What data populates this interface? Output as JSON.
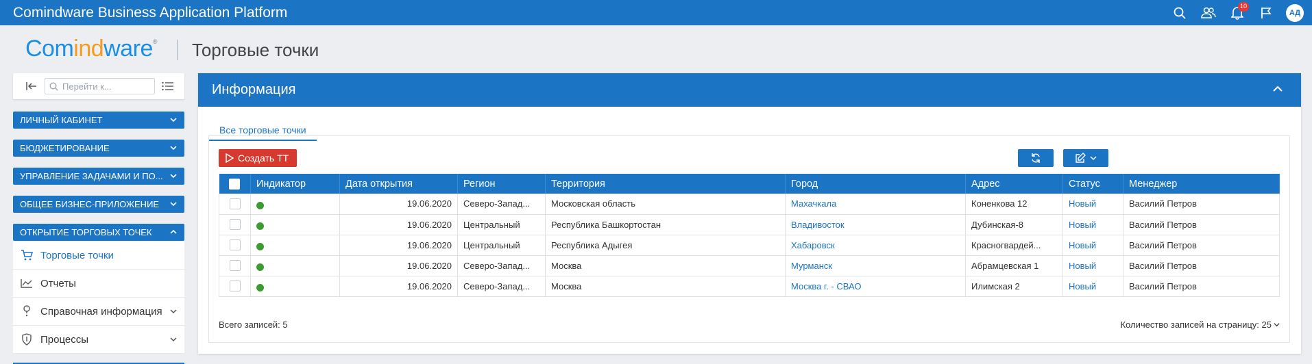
{
  "app": {
    "title": "Comindware Business Application Platform",
    "notifications_count": "10",
    "user_initials": "АД"
  },
  "header": {
    "logo_main": "Com",
    "logo_accent": "ind",
    "logo_tail": "ware",
    "logo_mark": "®",
    "page_title": "Торговые точки"
  },
  "sidebar": {
    "search_placeholder": "Перейти к...",
    "sections": [
      {
        "label": "Личный кабинет"
      },
      {
        "label": "Бюджетирование"
      },
      {
        "label": "Управление задачами и по..."
      },
      {
        "label": "Общее бизнес-приложение"
      },
      {
        "label": "Открытие торговых точек"
      }
    ],
    "items": [
      {
        "label": "Торговые точки",
        "icon": "cart-icon"
      },
      {
        "label": "Отчеты",
        "icon": "chart-icon"
      },
      {
        "label": "Справочная информация",
        "icon": "info-icon"
      },
      {
        "label": "Процессы",
        "icon": "shield-icon"
      }
    ]
  },
  "panel": {
    "title": "Информация",
    "tab": "Все торговые точки",
    "create_button": "Создать ТТ",
    "columns": [
      "Индикатор",
      "Дата открытия",
      "Регион",
      "Территория",
      "Город",
      "Адрес",
      "Статус",
      "Менеджер"
    ],
    "rows": [
      {
        "date": "19.06.2020",
        "region": "Северо-Запад...",
        "territory": "Московская область",
        "city": "Махачкала",
        "address": "Коненкова 12",
        "status": "Новый",
        "manager": "Василий Петров"
      },
      {
        "date": "19.06.2020",
        "region": "Центральный",
        "territory": "Республика Башкортостан",
        "city": "Владивосток",
        "address": "Дубинская-8",
        "status": "Новый",
        "manager": "Василий Петров"
      },
      {
        "date": "19.06.2020",
        "region": "Центральный",
        "territory": "Республика Адыгея",
        "city": "Хабаровск",
        "address": "Красногвардей...",
        "status": "Новый",
        "manager": "Василий Петров"
      },
      {
        "date": "19.06.2020",
        "region": "Северо-Запад...",
        "territory": "Москва",
        "city": "Мурманск",
        "address": "Абрамцевская 1",
        "status": "Новый",
        "manager": "Василий Петров"
      },
      {
        "date": "19.06.2020",
        "region": "Северо-Запад...",
        "territory": "Москва",
        "city": "Москва г. - СВАО",
        "address": "Илимская 2",
        "status": "Новый",
        "manager": "Василий Петров"
      }
    ],
    "total_label": "Всего записей: 5",
    "page_size_label": "Количество записей на страницу: 25"
  },
  "colors": {
    "brand": "#1b74c4",
    "danger": "#d63a2f",
    "indicator": "#3b9d2f",
    "logo_blue": "#1b8fe3",
    "logo_orange": "#f59b1e"
  }
}
